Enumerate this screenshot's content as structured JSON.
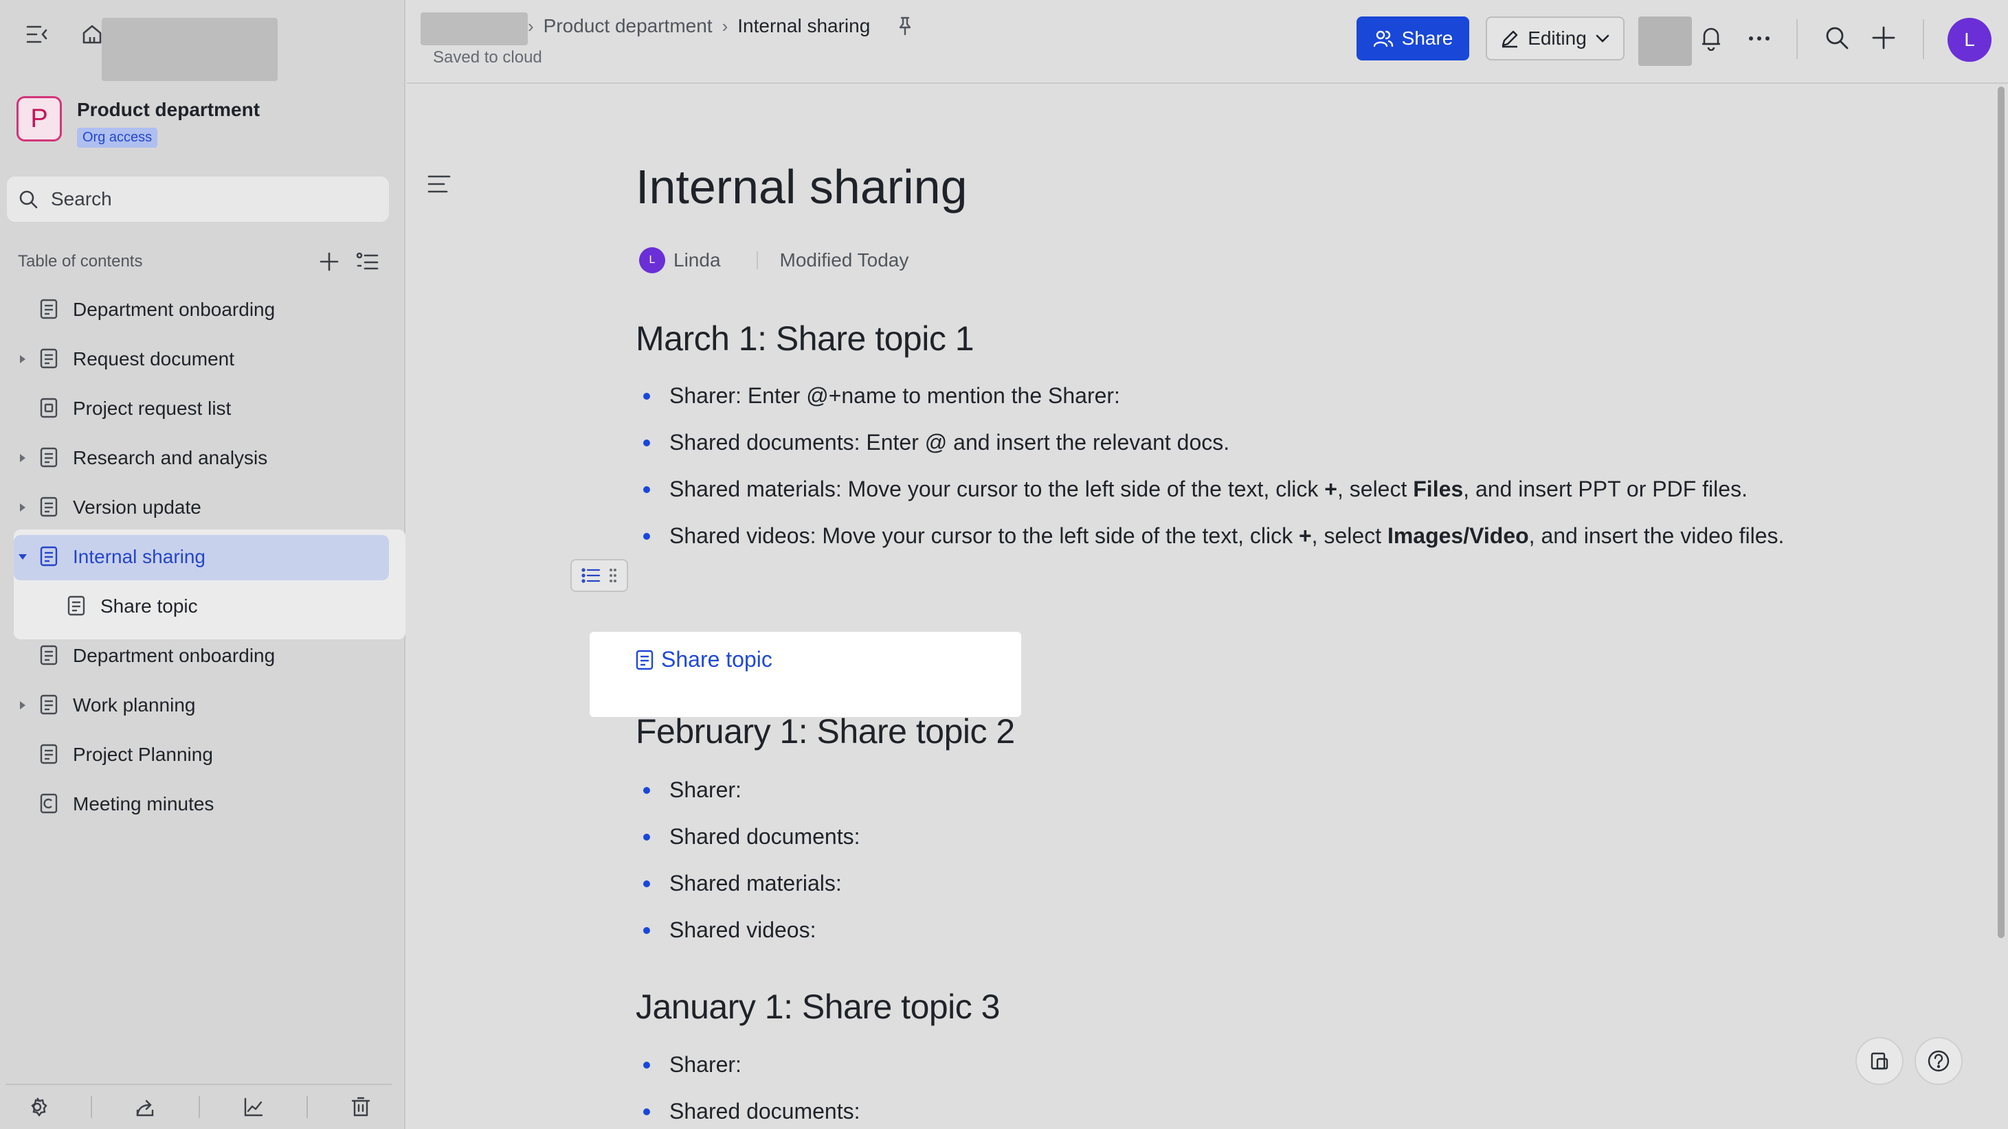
{
  "sidebar": {
    "space_name": "Product department",
    "space_initial": "P",
    "space_badge": "Org access",
    "search_placeholder": "Search",
    "toc_label": "Table of contents",
    "items": [
      {
        "label": "Department onboarding",
        "has_children": false,
        "icon": "doc-icon"
      },
      {
        "label": "Request document",
        "has_children": true,
        "icon": "doc-icon"
      },
      {
        "label": "Project request list",
        "has_children": false,
        "icon": "base-icon"
      },
      {
        "label": "Research and analysis",
        "has_children": true,
        "icon": "doc-icon"
      },
      {
        "label": "Version update",
        "has_children": true,
        "icon": "doc-icon"
      },
      {
        "label": "Internal sharing",
        "has_children": true,
        "expanded": true,
        "active": true,
        "icon": "doc-icon"
      },
      {
        "label": "Share topic",
        "child": true,
        "icon": "doc-icon"
      },
      {
        "label": "Department onboarding",
        "has_children": false,
        "icon": "doc-icon"
      },
      {
        "label": "Work planning",
        "has_children": true,
        "icon": "doc-icon"
      },
      {
        "label": "Project Planning",
        "has_children": false,
        "icon": "doc-icon"
      },
      {
        "label": "Meeting minutes",
        "has_children": false,
        "icon": "calendar-doc-icon"
      }
    ]
  },
  "topbar": {
    "breadcrumb": [
      "Product department",
      "Internal sharing"
    ],
    "saved_status": "Saved to cloud",
    "share_label": "Share",
    "edit_label": "Editing",
    "user_initial": "L"
  },
  "doc": {
    "title": "Internal sharing",
    "author": "Linda",
    "author_initial": "L",
    "modified": "Modified Today",
    "link_card": "Share topic",
    "sections": [
      {
        "heading": "March 1: Share topic 1",
        "bullets": [
          {
            "parts": [
              {
                "t": "Sharer: Enter @+name to mention the Sharer:"
              }
            ]
          },
          {
            "parts": [
              {
                "t": "Shared documents: Enter @ and insert the relevant docs."
              }
            ]
          },
          {
            "parts": [
              {
                "t": "Shared materials: Move your cursor to the left side of the text, click "
              },
              {
                "t": "+",
                "b": true
              },
              {
                "t": ", select "
              },
              {
                "t": "Files",
                "b": true
              },
              {
                "t": ", and insert PPT or PDF files."
              }
            ]
          },
          {
            "parts": [
              {
                "t": "Shared videos: Move your cursor to the left side of the text, click "
              },
              {
                "t": "+",
                "b": true
              },
              {
                "t": ", select "
              },
              {
                "t": "Images/Video",
                "b": true
              },
              {
                "t": ", and insert the video files."
              }
            ]
          }
        ]
      },
      {
        "heading": "February 1: Share topic 2",
        "bullets": [
          {
            "parts": [
              {
                "t": "Sharer:"
              }
            ]
          },
          {
            "parts": [
              {
                "t": "Shared documents:"
              }
            ]
          },
          {
            "parts": [
              {
                "t": "Shared materials:"
              }
            ]
          },
          {
            "parts": [
              {
                "t": "Shared videos:"
              }
            ]
          }
        ]
      },
      {
        "heading": "January 1: Share topic 3",
        "bullets": [
          {
            "parts": [
              {
                "t": "Sharer:"
              }
            ]
          },
          {
            "parts": [
              {
                "t": "Shared documents:"
              }
            ]
          }
        ]
      }
    ]
  },
  "colors": {
    "accent": "#1947d8",
    "active_text": "#2546c7",
    "avatar": "#6a2fd6",
    "space_icon": "#d23579"
  }
}
